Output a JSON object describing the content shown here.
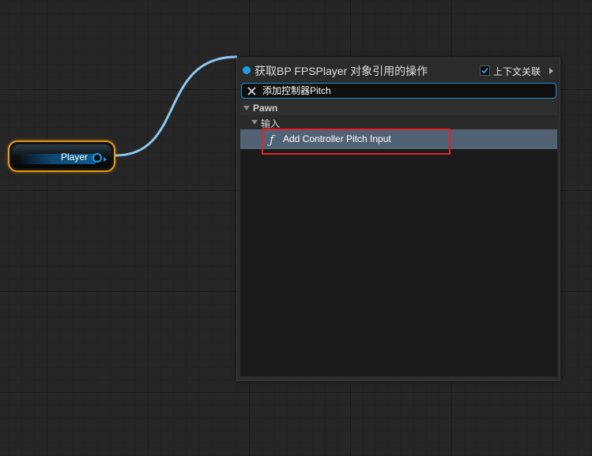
{
  "player_node": {
    "label": "Player",
    "pin_color": "#1e9fe8",
    "border_color": "#e89a12"
  },
  "wire_color": "#8ec8f2",
  "action_menu": {
    "title": "获取BP FPSPlayer 对象引用的操作",
    "context_sensitive": {
      "label": "上下文关联",
      "checked": true
    },
    "search": {
      "value": "添加控制器Pitch",
      "clear_icon": "close-icon"
    },
    "categories": [
      {
        "label": "Pawn",
        "subcategories": [
          {
            "label": "输入",
            "items": [
              {
                "icon": "function-icon",
                "icon_glyph": "ƒ",
                "label": "Add Controller Pitch Input",
                "selected": true
              }
            ]
          }
        ]
      }
    ]
  },
  "accent_colors": {
    "selection": "#526275",
    "search_border": "#1e8fd6",
    "annotation_box": "#e0202a"
  }
}
